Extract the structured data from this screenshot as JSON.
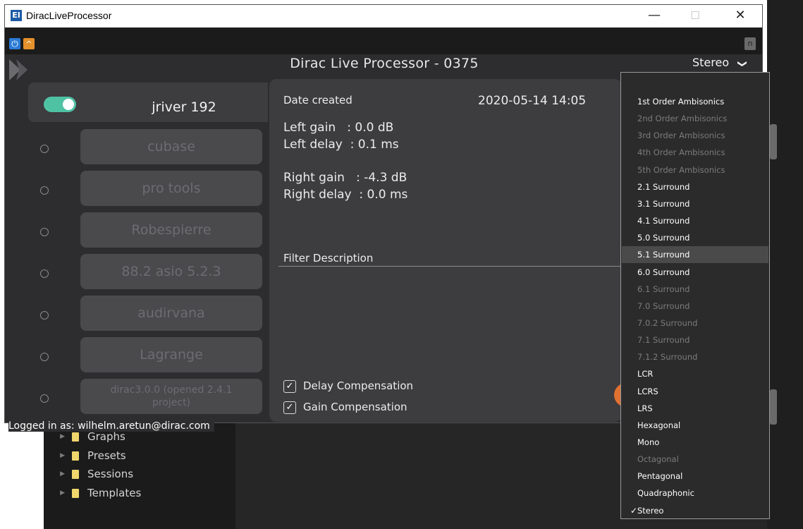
{
  "window": {
    "title": "DiracLiveProcessor",
    "minimize_glyph": "—",
    "maximize_glyph": "☐",
    "close_glyph": "✕"
  },
  "toolbar": {
    "power_glyph": "⏻",
    "up_glyph": "^",
    "n_label": "n"
  },
  "header": {
    "title": "Dirac Live Processor - 0375",
    "output_mode": "Stereo",
    "chevron": "❯"
  },
  "filters": {
    "active": "jriver 192",
    "presets": [
      "cubase",
      "pro tools",
      "Robespierre",
      "88.2 asio 5.2.3",
      "audirvana",
      "Lagrange",
      "dirac3.0.0 (opened 2.4.1 project)"
    ]
  },
  "info": {
    "date_label": "Date created",
    "date_value": "2020-05-14 14:05",
    "left_gain": "Left gain   : 0.0 dB",
    "left_delay": "Left delay  : 0.1 ms",
    "right_gain": "Right gain   : -4.3 dB",
    "right_delay": "Right delay  : 0.0 ms",
    "filter_description_label": "Filter Description",
    "delay_compensation": "Delay Compensation",
    "gain_compensation": "Gain Compensation",
    "check_glyph": "✓"
  },
  "status": {
    "logged_in": "Logged in as: wilhelm.aretun@dirac.com"
  },
  "tree": {
    "items": [
      "Graphs",
      "Presets",
      "Sessions",
      "Templates"
    ],
    "arrow": "▶"
  },
  "dropdown": {
    "check_glyph": "✓",
    "items": [
      {
        "label": "1st Order Ambisonics",
        "enabled": true
      },
      {
        "label": "2nd Order Ambisonics",
        "enabled": false
      },
      {
        "label": "3rd Order Ambisonics",
        "enabled": false
      },
      {
        "label": "4th Order Ambisonics",
        "enabled": false
      },
      {
        "label": "5th Order Ambisonics",
        "enabled": false
      },
      {
        "label": "2.1 Surround",
        "enabled": true
      },
      {
        "label": "3.1 Surround",
        "enabled": true
      },
      {
        "label": "4.1 Surround",
        "enabled": true
      },
      {
        "label": "5.0 Surround",
        "enabled": true
      },
      {
        "label": "5.1 Surround",
        "enabled": true,
        "hovered": true
      },
      {
        "label": "6.0 Surround",
        "enabled": true
      },
      {
        "label": "6.1 Surround",
        "enabled": false
      },
      {
        "label": "7.0 Surround",
        "enabled": false
      },
      {
        "label": "7.0.2 Surround",
        "enabled": false
      },
      {
        "label": "7.1 Surround",
        "enabled": false
      },
      {
        "label": "7.1.2 Surround",
        "enabled": false
      },
      {
        "label": "LCR",
        "enabled": true
      },
      {
        "label": "LCRS",
        "enabled": true
      },
      {
        "label": "LRS",
        "enabled": true
      },
      {
        "label": "Hexagonal",
        "enabled": true
      },
      {
        "label": "Mono",
        "enabled": true
      },
      {
        "label": "Octagonal",
        "enabled": false
      },
      {
        "label": "Pentagonal",
        "enabled": true
      },
      {
        "label": "Quadraphonic",
        "enabled": true
      },
      {
        "label": "Stereo",
        "enabled": true,
        "selected": true
      }
    ]
  },
  "colors": {
    "accent_toggle": "#4fc2a4",
    "orange": "#e6912b",
    "blue": "#2a7bd6"
  }
}
